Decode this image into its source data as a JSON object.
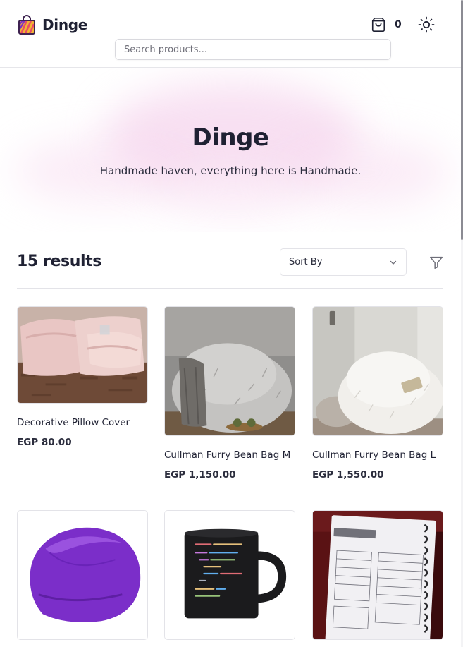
{
  "header": {
    "brand": "Dinge",
    "cart_count": "0",
    "search_placeholder": "Search products..."
  },
  "hero": {
    "title": "Dinge",
    "subtitle": "Handmade haven, everything here is Handmade."
  },
  "results": {
    "count_label": "15 results",
    "sort_label": "Sort By"
  },
  "products": [
    {
      "name": "Decorative Pillow Cover",
      "price": "EGP 80.00"
    },
    {
      "name": "Cullman Furry Bean Bag M",
      "price": "EGP 1,150.00"
    },
    {
      "name": "Cullman Furry Bean Bag L",
      "price": "EGP 1,550.00"
    },
    {
      "name": "",
      "price": ""
    },
    {
      "name": "",
      "price": ""
    },
    {
      "name": "",
      "price": ""
    }
  ],
  "colors": {
    "accent": "#e94b67",
    "text": "#1f2133",
    "border": "#e3e3e8",
    "bean_bag_purple": "#7b2ec9"
  },
  "icons": {
    "logo": "shopping-bag-logo",
    "cart": "shopping-bag-icon",
    "theme": "sun-icon",
    "sort": "chevron-down-icon",
    "filter": "filter-icon"
  }
}
